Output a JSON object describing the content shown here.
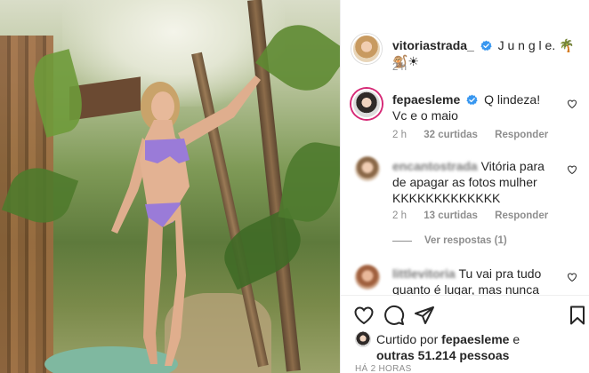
{
  "post": {
    "author": "vitoriastrada_",
    "caption": "J u n g l e. 🌴🐒☀",
    "caption_time": "2 h"
  },
  "comments": [
    {
      "user": "fepaesleme",
      "verified": true,
      "text": "Q lindeza! Vc e o maio",
      "time": "2 h",
      "likes": "32 curtidas",
      "reply": "Responder"
    },
    {
      "user": "encantostrada",
      "text": "Vitória para de apagar as fotos mulher KKKKKKKKKKKKK",
      "time": "2 h",
      "likes": "13 curtidas",
      "reply": "Responder",
      "view_replies": "Ver respostas (1)"
    },
    {
      "user": "littlevitoria",
      "text": "Tu vai pra tudo quanto é lugar, mas nunca vem"
    }
  ],
  "liked_by": {
    "prefix": "Curtido por",
    "user": "fepaesleme",
    "middle": "e",
    "others": "outras 51.214 pessoas"
  },
  "posted_ago": "HÁ 2 HORAS",
  "icons": {
    "verified": "verified-badge-icon",
    "like": "heart-icon",
    "comment": "comment-bubble-icon",
    "share": "paper-plane-icon",
    "save": "bookmark-icon"
  },
  "colors": {
    "verified": "#3897f0",
    "text": "#262626",
    "meta": "#8e8e8e",
    "story_ring": "#d62976"
  }
}
